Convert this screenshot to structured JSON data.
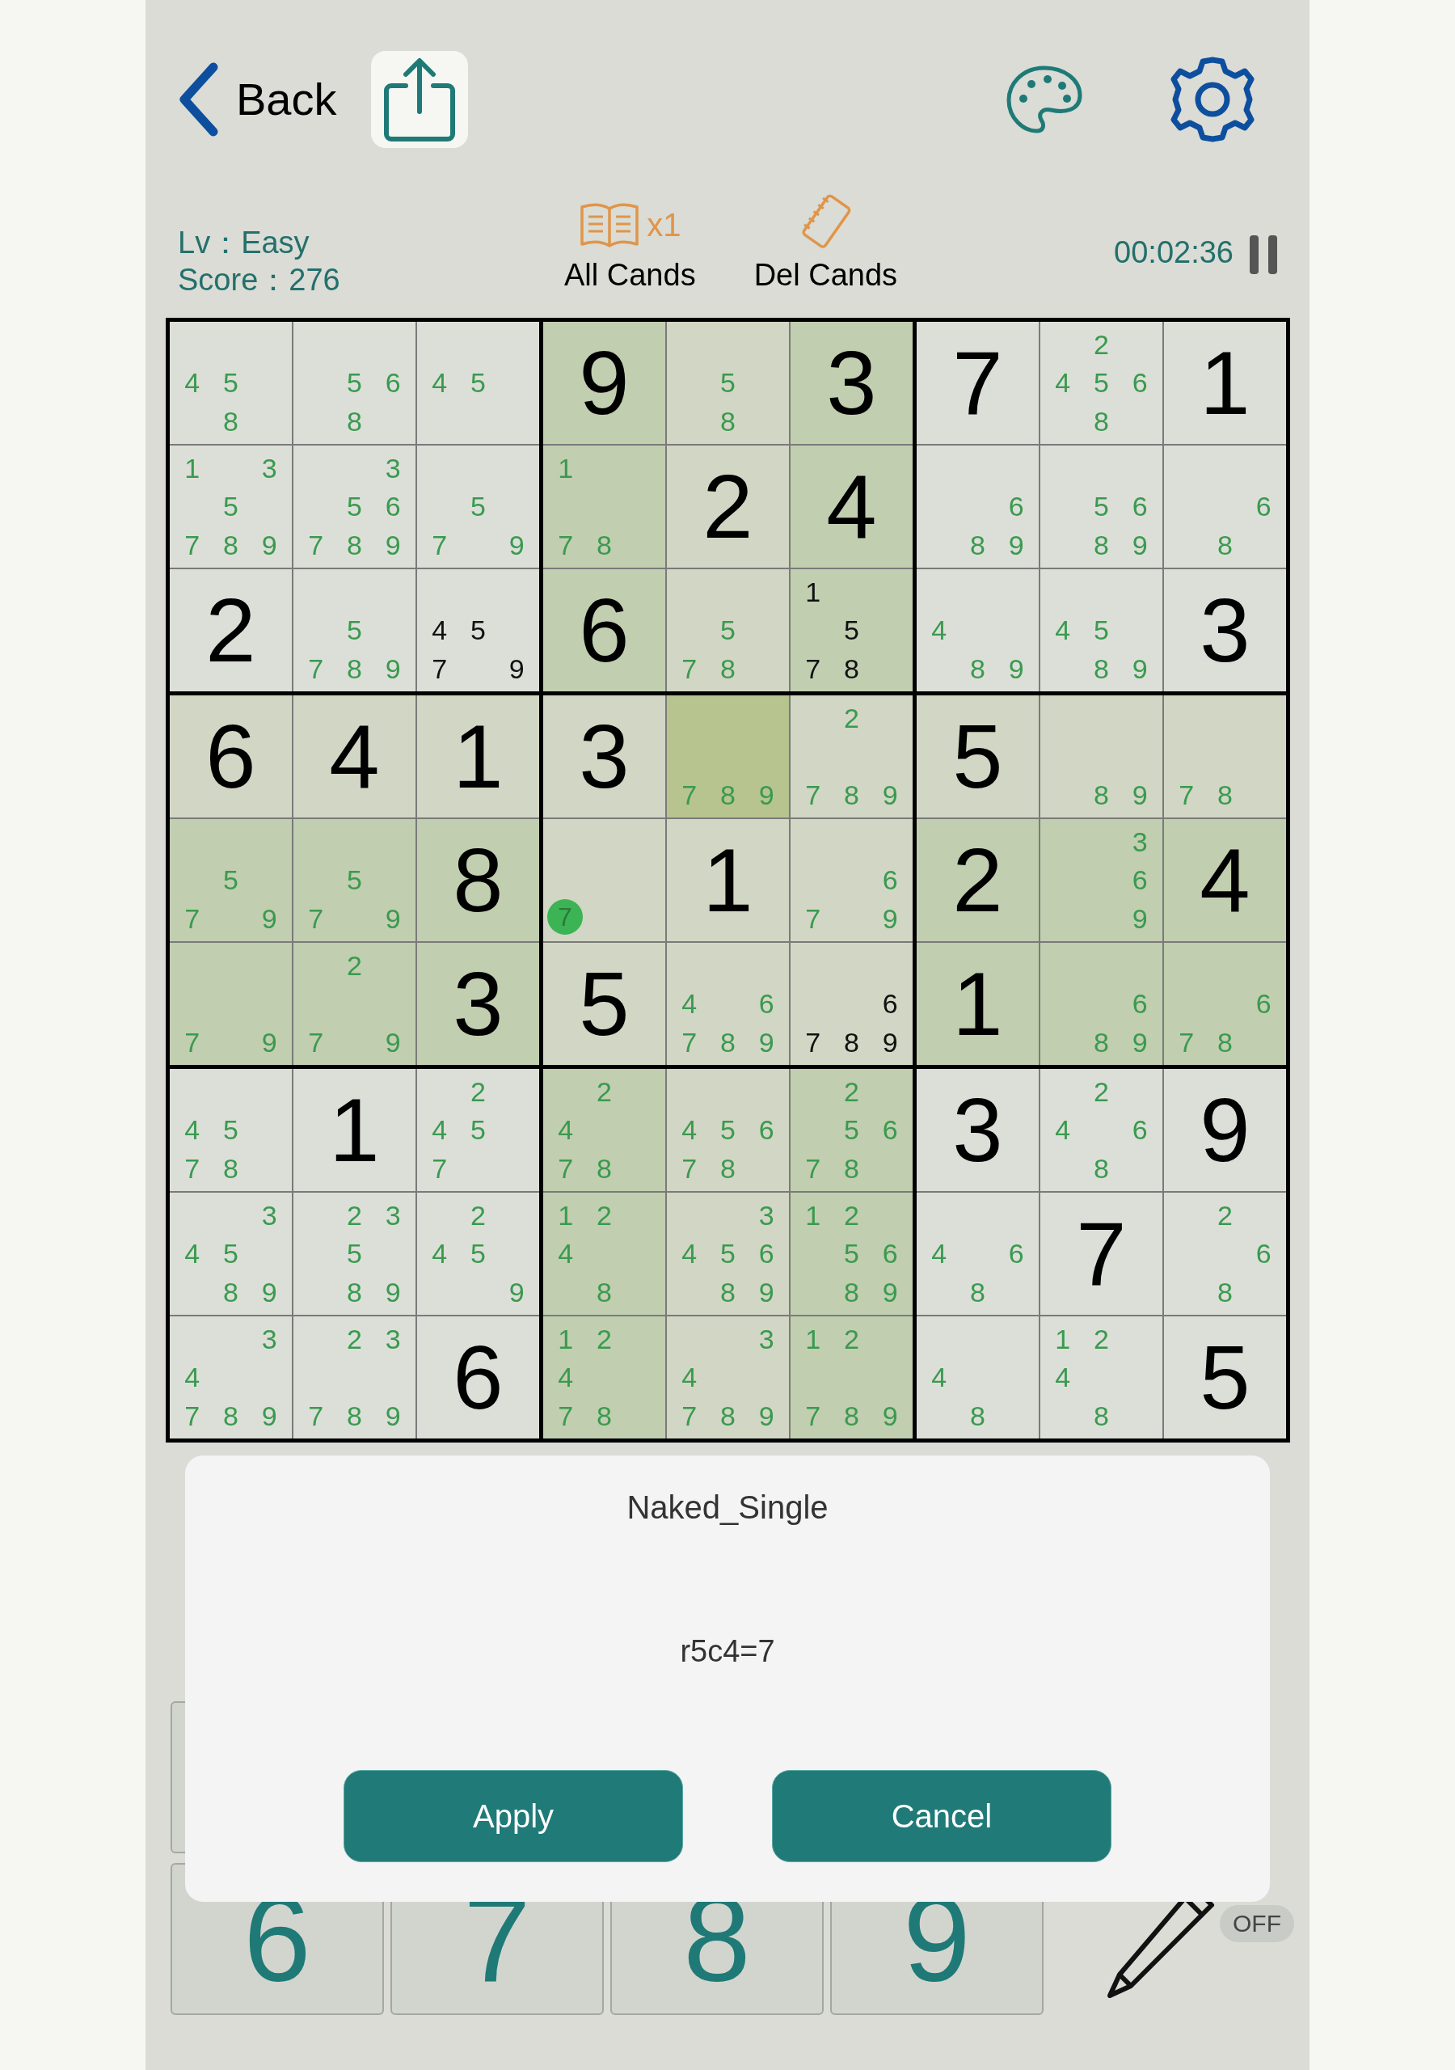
{
  "back": {
    "label": "Back"
  },
  "level": "Lv：Easy",
  "score": "Score：276",
  "all_cands": {
    "count": "x1",
    "label": "All Cands"
  },
  "del_cands": {
    "label": "Del Cands"
  },
  "timer": "00:02:36",
  "grid": {
    "rows": [
      {
        "cells": [
          {
            "kind": "plain",
            "selected": false,
            "color": "#3a9a4f",
            "candidates": [
              {
                "digit": "4",
                "kind": "ml"
              },
              {
                "digit": "5",
                "kind": "mc"
              },
              {
                "digit": "8",
                "kind": "bc"
              }
            ]
          },
          {
            "kind": "plain",
            "selected": false,
            "color": "#3a9a4f",
            "candidates": [
              {
                "digit": "5",
                "kind": "mc"
              },
              {
                "digit": "6",
                "kind": "mr"
              },
              {
                "digit": "8",
                "kind": "bc"
              }
            ]
          },
          {
            "kind": "plain",
            "selected": false,
            "color": "#3a9a4f",
            "candidates": [
              {
                "digit": "4",
                "kind": "ml"
              },
              {
                "digit": "5",
                "kind": "mc"
              }
            ]
          },
          {
            "kind": "strong",
            "selected": false,
            "value": "9"
          },
          {
            "kind": "line",
            "selected": false,
            "color": "#3a9a4f",
            "candidates": [
              {
                "digit": "5",
                "kind": "mc"
              },
              {
                "digit": "8",
                "kind": "bc"
              }
            ]
          },
          {
            "kind": "strong",
            "selected": false,
            "value": "3"
          },
          {
            "kind": "plain",
            "selected": false,
            "value": "7"
          },
          {
            "kind": "plain",
            "selected": false,
            "color": "#3a9a4f",
            "candidates": [
              {
                "digit": "2",
                "kind": "tc"
              },
              {
                "digit": "4",
                "kind": "ml"
              },
              {
                "digit": "5",
                "kind": "mc"
              },
              {
                "digit": "6",
                "kind": "mr"
              },
              {
                "digit": "8",
                "kind": "bc"
              }
            ]
          },
          {
            "kind": "plain",
            "selected": false,
            "value": "1"
          }
        ]
      },
      {
        "cells": [
          {
            "kind": "plain",
            "selected": false,
            "color": "#3a9a4f",
            "candidates": [
              {
                "digit": "1",
                "kind": "tl"
              },
              {
                "digit": "3",
                "kind": "tr"
              },
              {
                "digit": "5",
                "kind": "mc"
              },
              {
                "digit": "7",
                "kind": "bl"
              },
              {
                "digit": "8",
                "kind": "bc"
              },
              {
                "digit": "9",
                "kind": "br"
              }
            ]
          },
          {
            "kind": "plain",
            "selected": false,
            "color": "#3a9a4f",
            "candidates": [
              {
                "digit": "3",
                "kind": "tr"
              },
              {
                "digit": "5",
                "kind": "mc"
              },
              {
                "digit": "6",
                "kind": "mr"
              },
              {
                "digit": "7",
                "kind": "bl"
              },
              {
                "digit": "8",
                "kind": "bc"
              },
              {
                "digit": "9",
                "kind": "br"
              }
            ]
          },
          {
            "kind": "plain",
            "selected": false,
            "color": "#3a9a4f",
            "candidates": [
              {
                "digit": "5",
                "kind": "mc"
              },
              {
                "digit": "7",
                "kind": "bl"
              },
              {
                "digit": "9",
                "kind": "br"
              }
            ]
          },
          {
            "kind": "strong",
            "selected": false,
            "color": "#3a9a4f",
            "candidates": [
              {
                "digit": "1",
                "kind": "tl"
              },
              {
                "digit": "7",
                "kind": "bl"
              },
              {
                "digit": "8",
                "kind": "bc"
              }
            ]
          },
          {
            "kind": "line",
            "selected": false,
            "value": "2"
          },
          {
            "kind": "strong",
            "selected": false,
            "value": "4"
          },
          {
            "kind": "plain",
            "selected": false,
            "color": "#3a9a4f",
            "candidates": [
              {
                "digit": "6",
                "kind": "mr"
              },
              {
                "digit": "8",
                "kind": "bc"
              },
              {
                "digit": "9",
                "kind": "br"
              }
            ]
          },
          {
            "kind": "plain",
            "selected": false,
            "color": "#3a9a4f",
            "candidates": [
              {
                "digit": "5",
                "kind": "mc"
              },
              {
                "digit": "6",
                "kind": "mr"
              },
              {
                "digit": "8",
                "kind": "bc"
              },
              {
                "digit": "9",
                "kind": "br"
              }
            ]
          },
          {
            "kind": "plain",
            "selected": false,
            "color": "#3a9a4f",
            "candidates": [
              {
                "digit": "6",
                "kind": "mr"
              },
              {
                "digit": "8",
                "kind": "bc"
              }
            ]
          }
        ]
      },
      {
        "cells": [
          {
            "kind": "plain",
            "selected": false,
            "value": "2"
          },
          {
            "kind": "plain",
            "selected": false,
            "color": "#3a9a4f",
            "candidates": [
              {
                "digit": "5",
                "kind": "mc"
              },
              {
                "digit": "7",
                "kind": "bl"
              },
              {
                "digit": "8",
                "kind": "bc"
              },
              {
                "digit": "9",
                "kind": "br"
              }
            ]
          },
          {
            "kind": "plain",
            "selected": false,
            "color": "#111111",
            "candidates": [
              {
                "digit": "4",
                "kind": "ml"
              },
              {
                "digit": "5",
                "kind": "mc"
              },
              {
                "digit": "7",
                "kind": "bl"
              },
              {
                "digit": "9",
                "kind": "br"
              }
            ]
          },
          {
            "kind": "strong",
            "selected": false,
            "value": "6"
          },
          {
            "kind": "line",
            "selected": false,
            "color": "#3a9a4f",
            "candidates": [
              {
                "digit": "5",
                "kind": "mc"
              },
              {
                "digit": "7",
                "kind": "bl"
              },
              {
                "digit": "8",
                "kind": "bc"
              }
            ]
          },
          {
            "kind": "strong",
            "selected": false,
            "color": "#111111",
            "candidates": [
              {
                "digit": "1",
                "kind": "tl"
              },
              {
                "digit": "5",
                "kind": "mc"
              },
              {
                "digit": "7",
                "kind": "bl"
              },
              {
                "digit": "8",
                "kind": "bc"
              }
            ]
          },
          {
            "kind": "plain",
            "selected": false,
            "color": "#3a9a4f",
            "candidates": [
              {
                "digit": "4",
                "kind": "ml"
              },
              {
                "digit": "8",
                "kind": "bc"
              },
              {
                "digit": "9",
                "kind": "br"
              }
            ]
          },
          {
            "kind": "plain",
            "selected": false,
            "color": "#3a9a4f",
            "candidates": [
              {
                "digit": "4",
                "kind": "ml"
              },
              {
                "digit": "5",
                "kind": "mc"
              },
              {
                "digit": "8",
                "kind": "bc"
              },
              {
                "digit": "9",
                "kind": "br"
              }
            ]
          },
          {
            "kind": "plain",
            "selected": false,
            "value": "3"
          }
        ]
      },
      {
        "cells": [
          {
            "kind": "line",
            "selected": false,
            "value": "6"
          },
          {
            "kind": "line",
            "selected": false,
            "value": "4"
          },
          {
            "kind": "line",
            "selected": false,
            "value": "1"
          },
          {
            "kind": "line",
            "selected": false,
            "value": "3"
          },
          {
            "kind": "line",
            "selected": true,
            "color": "#3a9a4f",
            "candidates": [
              {
                "digit": "7",
                "kind": "bl"
              },
              {
                "digit": "8",
                "kind": "bc"
              },
              {
                "digit": "9",
                "kind": "br"
              }
            ]
          },
          {
            "kind": "line",
            "selected": false,
            "color": "#3a9a4f",
            "candidates": [
              {
                "digit": "2",
                "kind": "tc"
              },
              {
                "digit": "7",
                "kind": "bl"
              },
              {
                "digit": "8",
                "kind": "bc"
              },
              {
                "digit": "9",
                "kind": "br"
              }
            ]
          },
          {
            "kind": "line",
            "selected": false,
            "value": "5"
          },
          {
            "kind": "line",
            "selected": false,
            "color": "#3a9a4f",
            "candidates": [
              {
                "digit": "8",
                "kind": "bc"
              },
              {
                "digit": "9",
                "kind": "br"
              }
            ]
          },
          {
            "kind": "line",
            "selected": false,
            "color": "#3a9a4f",
            "candidates": [
              {
                "digit": "7",
                "kind": "bl"
              },
              {
                "digit": "8",
                "kind": "bc"
              }
            ]
          }
        ]
      },
      {
        "cells": [
          {
            "kind": "strong",
            "selected": false,
            "color": "#3a9a4f",
            "candidates": [
              {
                "digit": "5",
                "kind": "mc"
              },
              {
                "digit": "7",
                "kind": "bl"
              },
              {
                "digit": "9",
                "kind": "br"
              }
            ]
          },
          {
            "kind": "strong",
            "selected": false,
            "color": "#3a9a4f",
            "candidates": [
              {
                "digit": "5",
                "kind": "mc"
              },
              {
                "digit": "7",
                "kind": "bl"
              },
              {
                "digit": "9",
                "kind": "br"
              }
            ]
          },
          {
            "kind": "strong",
            "selected": false,
            "value": "8"
          },
          {
            "kind": "line",
            "selected": false,
            "hint": "7"
          },
          {
            "kind": "line",
            "selected": false,
            "value": "1"
          },
          {
            "kind": "line",
            "selected": false,
            "color": "#3a9a4f",
            "candidates": [
              {
                "digit": "6",
                "kind": "mr"
              },
              {
                "digit": "7",
                "kind": "bl"
              },
              {
                "digit": "9",
                "kind": "br"
              }
            ]
          },
          {
            "kind": "strong",
            "selected": false,
            "value": "2"
          },
          {
            "kind": "strong",
            "selected": false,
            "color": "#3a9a4f",
            "candidates": [
              {
                "digit": "3",
                "kind": "tr"
              },
              {
                "digit": "6",
                "kind": "mr"
              },
              {
                "digit": "9",
                "kind": "br"
              }
            ]
          },
          {
            "kind": "strong",
            "selected": false,
            "value": "4"
          }
        ]
      },
      {
        "cells": [
          {
            "kind": "strong",
            "selected": false,
            "color": "#3a9a4f",
            "candidates": [
              {
                "digit": "7",
                "kind": "bl"
              },
              {
                "digit": "9",
                "kind": "br"
              }
            ]
          },
          {
            "kind": "strong",
            "selected": false,
            "color": "#3a9a4f",
            "candidates": [
              {
                "digit": "2",
                "kind": "tc"
              },
              {
                "digit": "7",
                "kind": "bl"
              },
              {
                "digit": "9",
                "kind": "br"
              }
            ]
          },
          {
            "kind": "strong",
            "selected": false,
            "value": "3"
          },
          {
            "kind": "line",
            "selected": false,
            "value": "5"
          },
          {
            "kind": "line",
            "selected": false,
            "color": "#3a9a4f",
            "candidates": [
              {
                "digit": "4",
                "kind": "ml"
              },
              {
                "digit": "6",
                "kind": "mr"
              },
              {
                "digit": "7",
                "kind": "bl"
              },
              {
                "digit": "8",
                "kind": "bc"
              },
              {
                "digit": "9",
                "kind": "br"
              }
            ]
          },
          {
            "kind": "line",
            "selected": false,
            "color": "#111111",
            "candidates": [
              {
                "digit": "6",
                "kind": "mr"
              },
              {
                "digit": "7",
                "kind": "bl"
              },
              {
                "digit": "8",
                "kind": "bc"
              },
              {
                "digit": "9",
                "kind": "br"
              }
            ]
          },
          {
            "kind": "strong",
            "selected": false,
            "value": "1"
          },
          {
            "kind": "strong",
            "selected": false,
            "color": "#3a9a4f",
            "candidates": [
              {
                "digit": "6",
                "kind": "mr"
              },
              {
                "digit": "8",
                "kind": "bc"
              },
              {
                "digit": "9",
                "kind": "br"
              }
            ]
          },
          {
            "kind": "strong",
            "selected": false,
            "color": "#3a9a4f",
            "candidates": [
              {
                "digit": "6",
                "kind": "mr"
              },
              {
                "digit": "7",
                "kind": "bl"
              },
              {
                "digit": "8",
                "kind": "bc"
              }
            ]
          }
        ]
      },
      {
        "cells": [
          {
            "kind": "plain",
            "selected": false,
            "color": "#3a9a4f",
            "candidates": [
              {
                "digit": "4",
                "kind": "ml"
              },
              {
                "digit": "5",
                "kind": "mc"
              },
              {
                "digit": "7",
                "kind": "bl"
              },
              {
                "digit": "8",
                "kind": "bc"
              }
            ]
          },
          {
            "kind": "plain",
            "selected": false,
            "value": "1"
          },
          {
            "kind": "plain",
            "selected": false,
            "color": "#3a9a4f",
            "candidates": [
              {
                "digit": "2",
                "kind": "tc"
              },
              {
                "digit": "4",
                "kind": "ml"
              },
              {
                "digit": "5",
                "kind": "mc"
              },
              {
                "digit": "7",
                "kind": "bl"
              }
            ]
          },
          {
            "kind": "strong",
            "selected": false,
            "color": "#3a9a4f",
            "candidates": [
              {
                "digit": "2",
                "kind": "tc"
              },
              {
                "digit": "4",
                "kind": "ml"
              },
              {
                "digit": "7",
                "kind": "bl"
              },
              {
                "digit": "8",
                "kind": "bc"
              }
            ]
          },
          {
            "kind": "line",
            "selected": false,
            "color": "#3a9a4f",
            "candidates": [
              {
                "digit": "4",
                "kind": "ml"
              },
              {
                "digit": "5",
                "kind": "mc"
              },
              {
                "digit": "6",
                "kind": "mr"
              },
              {
                "digit": "7",
                "kind": "bl"
              },
              {
                "digit": "8",
                "kind": "bc"
              }
            ]
          },
          {
            "kind": "strong",
            "selected": false,
            "color": "#3a9a4f",
            "candidates": [
              {
                "digit": "2",
                "kind": "tc"
              },
              {
                "digit": "5",
                "kind": "mc"
              },
              {
                "digit": "6",
                "kind": "mr"
              },
              {
                "digit": "7",
                "kind": "bl"
              },
              {
                "digit": "8",
                "kind": "bc"
              }
            ]
          },
          {
            "kind": "plain",
            "selected": false,
            "value": "3"
          },
          {
            "kind": "plain",
            "selected": false,
            "color": "#3a9a4f",
            "candidates": [
              {
                "digit": "2",
                "kind": "tc"
              },
              {
                "digit": "4",
                "kind": "ml"
              },
              {
                "digit": "6",
                "kind": "mr"
              },
              {
                "digit": "8",
                "kind": "bc"
              }
            ]
          },
          {
            "kind": "plain",
            "selected": false,
            "value": "9"
          }
        ]
      },
      {
        "cells": [
          {
            "kind": "plain",
            "selected": false,
            "color": "#3a9a4f",
            "candidates": [
              {
                "digit": "3",
                "kind": "tr"
              },
              {
                "digit": "4",
                "kind": "ml"
              },
              {
                "digit": "5",
                "kind": "mc"
              },
              {
                "digit": "8",
                "kind": "bc"
              },
              {
                "digit": "9",
                "kind": "br"
              }
            ]
          },
          {
            "kind": "plain",
            "selected": false,
            "color": "#3a9a4f",
            "candidates": [
              {
                "digit": "2",
                "kind": "tc"
              },
              {
                "digit": "3",
                "kind": "tr"
              },
              {
                "digit": "5",
                "kind": "mc"
              },
              {
                "digit": "8",
                "kind": "bc"
              },
              {
                "digit": "9",
                "kind": "br"
              }
            ]
          },
          {
            "kind": "plain",
            "selected": false,
            "color": "#3a9a4f",
            "candidates": [
              {
                "digit": "2",
                "kind": "tc"
              },
              {
                "digit": "4",
                "kind": "ml"
              },
              {
                "digit": "5",
                "kind": "mc"
              },
              {
                "digit": "9",
                "kind": "br"
              }
            ]
          },
          {
            "kind": "strong",
            "selected": false,
            "color": "#3a9a4f",
            "candidates": [
              {
                "digit": "1",
                "kind": "tl"
              },
              {
                "digit": "2",
                "kind": "tc"
              },
              {
                "digit": "4",
                "kind": "ml"
              },
              {
                "digit": "8",
                "kind": "bc"
              }
            ]
          },
          {
            "kind": "line",
            "selected": false,
            "color": "#3a9a4f",
            "candidates": [
              {
                "digit": "3",
                "kind": "tr"
              },
              {
                "digit": "4",
                "kind": "ml"
              },
              {
                "digit": "5",
                "kind": "mc"
              },
              {
                "digit": "6",
                "kind": "mr"
              },
              {
                "digit": "8",
                "kind": "bc"
              },
              {
                "digit": "9",
                "kind": "br"
              }
            ]
          },
          {
            "kind": "strong",
            "selected": false,
            "color": "#3a9a4f",
            "candidates": [
              {
                "digit": "1",
                "kind": "tl"
              },
              {
                "digit": "2",
                "kind": "tc"
              },
              {
                "digit": "5",
                "kind": "mc"
              },
              {
                "digit": "6",
                "kind": "mr"
              },
              {
                "digit": "8",
                "kind": "bc"
              },
              {
                "digit": "9",
                "kind": "br"
              }
            ]
          },
          {
            "kind": "plain",
            "selected": false,
            "color": "#3a9a4f",
            "candidates": [
              {
                "digit": "4",
                "kind": "ml"
              },
              {
                "digit": "6",
                "kind": "mr"
              },
              {
                "digit": "8",
                "kind": "bc"
              }
            ]
          },
          {
            "kind": "plain",
            "selected": false,
            "value": "7"
          },
          {
            "kind": "plain",
            "selected": false,
            "color": "#3a9a4f",
            "candidates": [
              {
                "digit": "2",
                "kind": "tc"
              },
              {
                "digit": "6",
                "kind": "mr"
              },
              {
                "digit": "8",
                "kind": "bc"
              }
            ]
          }
        ]
      },
      {
        "cells": [
          {
            "kind": "plain",
            "selected": false,
            "color": "#3a9a4f",
            "candidates": [
              {
                "digit": "3",
                "kind": "tr"
              },
              {
                "digit": "4",
                "kind": "ml"
              },
              {
                "digit": "7",
                "kind": "bl"
              },
              {
                "digit": "8",
                "kind": "bc"
              },
              {
                "digit": "9",
                "kind": "br"
              }
            ]
          },
          {
            "kind": "plain",
            "selected": false,
            "color": "#3a9a4f",
            "candidates": [
              {
                "digit": "2",
                "kind": "tc"
              },
              {
                "digit": "3",
                "kind": "tr"
              },
              {
                "digit": "7",
                "kind": "bl"
              },
              {
                "digit": "8",
                "kind": "bc"
              },
              {
                "digit": "9",
                "kind": "br"
              }
            ]
          },
          {
            "kind": "plain",
            "selected": false,
            "value": "6"
          },
          {
            "kind": "strong",
            "selected": false,
            "color": "#3a9a4f",
            "candidates": [
              {
                "digit": "1",
                "kind": "tl"
              },
              {
                "digit": "2",
                "kind": "tc"
              },
              {
                "digit": "4",
                "kind": "ml"
              },
              {
                "digit": "7",
                "kind": "bl"
              },
              {
                "digit": "8",
                "kind": "bc"
              }
            ]
          },
          {
            "kind": "line",
            "selected": false,
            "color": "#3a9a4f",
            "candidates": [
              {
                "digit": "3",
                "kind": "tr"
              },
              {
                "digit": "4",
                "kind": "ml"
              },
              {
                "digit": "7",
                "kind": "bl"
              },
              {
                "digit": "8",
                "kind": "bc"
              },
              {
                "digit": "9",
                "kind": "br"
              }
            ]
          },
          {
            "kind": "strong",
            "selected": false,
            "color": "#3a9a4f",
            "candidates": [
              {
                "digit": "1",
                "kind": "tl"
              },
              {
                "digit": "2",
                "kind": "tc"
              },
              {
                "digit": "7",
                "kind": "bl"
              },
              {
                "digit": "8",
                "kind": "bc"
              },
              {
                "digit": "9",
                "kind": "br"
              }
            ]
          },
          {
            "kind": "plain",
            "selected": false,
            "color": "#3a9a4f",
            "candidates": [
              {
                "digit": "4",
                "kind": "ml"
              },
              {
                "digit": "8",
                "kind": "bc"
              }
            ]
          },
          {
            "kind": "plain",
            "selected": false,
            "color": "#3a9a4f",
            "candidates": [
              {
                "digit": "1",
                "kind": "tl"
              },
              {
                "digit": "2",
                "kind": "tc"
              },
              {
                "digit": "4",
                "kind": "ml"
              },
              {
                "digit": "8",
                "kind": "bc"
              }
            ]
          },
          {
            "kind": "plain",
            "selected": false,
            "value": "5"
          }
        ]
      }
    ]
  },
  "keypad": {
    "keys": [
      "6",
      "7",
      "8",
      "9"
    ]
  },
  "pencil_mode": "OFF",
  "dialog": {
    "title": "Naked_Single",
    "message": "r5c4=7",
    "buttons": [
      "Apply",
      "Cancel"
    ]
  }
}
